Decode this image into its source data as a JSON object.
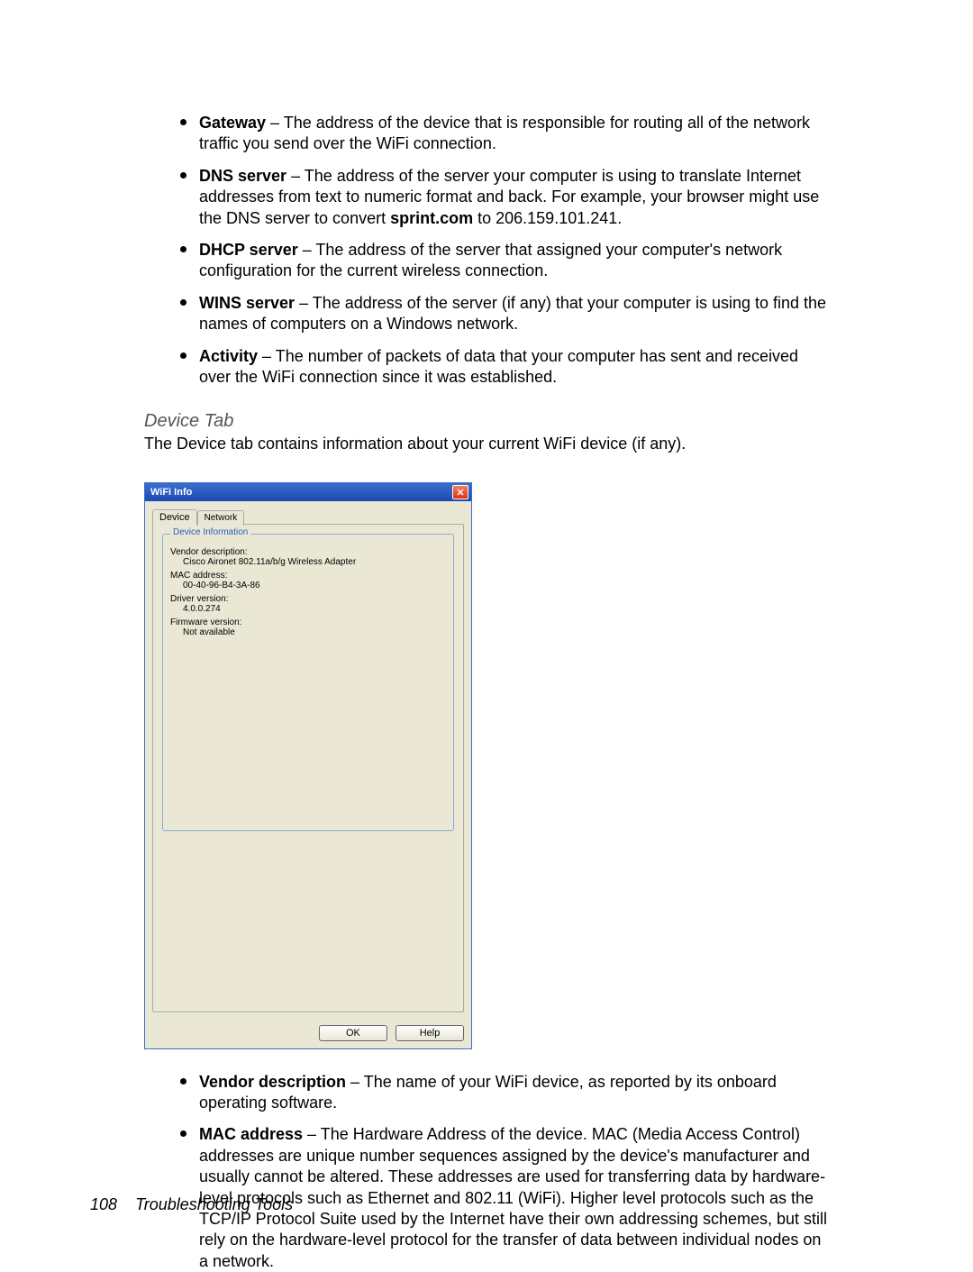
{
  "bullets_top": [
    {
      "term": "Gateway",
      "sep": " – ",
      "text": "The address of the device that is responsible for routing all of the network traffic you send over the WiFi connection."
    },
    {
      "term": "DNS server",
      "sep": " – ",
      "text_before": "The address of the server your computer is using to translate Internet addresses from text to numeric format and back. For example, your browser might use the DNS server to convert ",
      "inline_bold": "sprint.com",
      "text_after": " to 206.159.101.241."
    },
    {
      "term": "DHCP server",
      "sep": " – ",
      "text": "The address of the server that assigned your computer's network configuration for the current wireless connection."
    },
    {
      "term": "WINS server",
      "sep": " – ",
      "text": "The address of the server (if any) that your computer is using to find the names of computers on a Windows network."
    },
    {
      "term": "Activity",
      "sep": " – ",
      "text": "The number of packets of data that your computer has sent and received over the WiFi connection since it was established."
    }
  ],
  "section_title": "Device Tab",
  "intro": "The Device tab contains information about your current WiFi device (if any).",
  "window": {
    "title": "WiFi Info",
    "tabs": {
      "active": "Device",
      "inactive": "Network"
    },
    "group_label": "Device Information",
    "fields": [
      {
        "label": "Vendor description:",
        "value": "Cisco Aironet 802.11a/b/g Wireless Adapter"
      },
      {
        "label": "MAC address:",
        "value": "00-40-96-B4-3A-86"
      },
      {
        "label": "Driver version:",
        "value": "4.0.0.274"
      },
      {
        "label": "Firmware version:",
        "value": "Not available"
      }
    ],
    "buttons": {
      "ok": "OK",
      "help": "Help"
    }
  },
  "bullets_bottom": [
    {
      "term": "Vendor description",
      "sep": " – ",
      "text": "The name of your WiFi device, as reported by its onboard operating software."
    },
    {
      "term": "MAC address",
      "sep": " – ",
      "text": "The Hardware Address of the device. MAC (Media Access Control) addresses are unique number sequences assigned by the device's manufacturer and usually cannot be altered. These addresses are used for transferring data by hardware-level protocols such as Ethernet and 802.11 (WiFi). Higher level protocols such as the TCP/IP Protocol Suite used by the Internet have their own addressing schemes, but still rely on the hardware-level protocol for the transfer of data between individual nodes on a network."
    }
  ],
  "footer": {
    "page": "108",
    "title": "Troubleshooting Tools"
  }
}
